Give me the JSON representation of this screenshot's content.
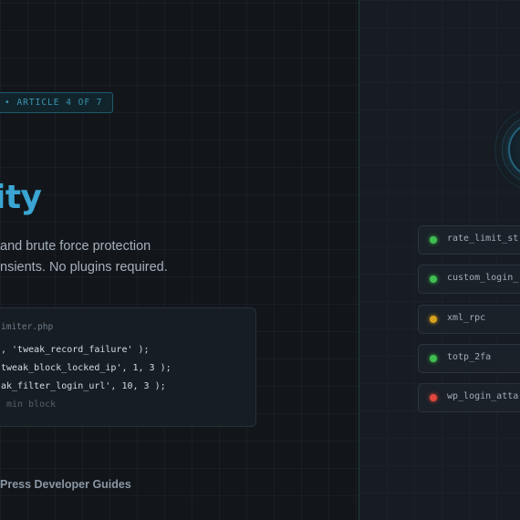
{
  "article": {
    "badge": "• ARTICLE 4 OF 7",
    "title": "ity",
    "subtitle_lines": [
      "and brute force protection",
      "nsients. No plugins required."
    ],
    "footer": "Press Developer Guides"
  },
  "code": {
    "filename": "imiter.php",
    "lines": [
      ", 'tweak_record_failure' );",
      "tweak_block_locked_ip', 1, 3 );",
      "ak_filter_login_url', 10, 3 );",
      "min block"
    ]
  },
  "status_list": [
    {
      "label": "rate_limit_st",
      "status": "ok",
      "color": "#3fbf4f"
    },
    {
      "label": "custom_login_",
      "status": "ok",
      "color": "#3fbf4f"
    },
    {
      "label": "xml_rpc",
      "status": "warning",
      "color": "#d9a21e"
    },
    {
      "label": "totp_2fa",
      "status": "ok",
      "color": "#3fbf4f"
    },
    {
      "label": "wp_login_atta",
      "status": "error",
      "color": "#e0473c"
    }
  ],
  "colors": {
    "accent": "#3aa5d3",
    "ok": "#3fbf4f",
    "warning": "#d9a21e",
    "error": "#e0473c"
  },
  "icons": {
    "shield_emblem": "shield-emblem-icon"
  }
}
